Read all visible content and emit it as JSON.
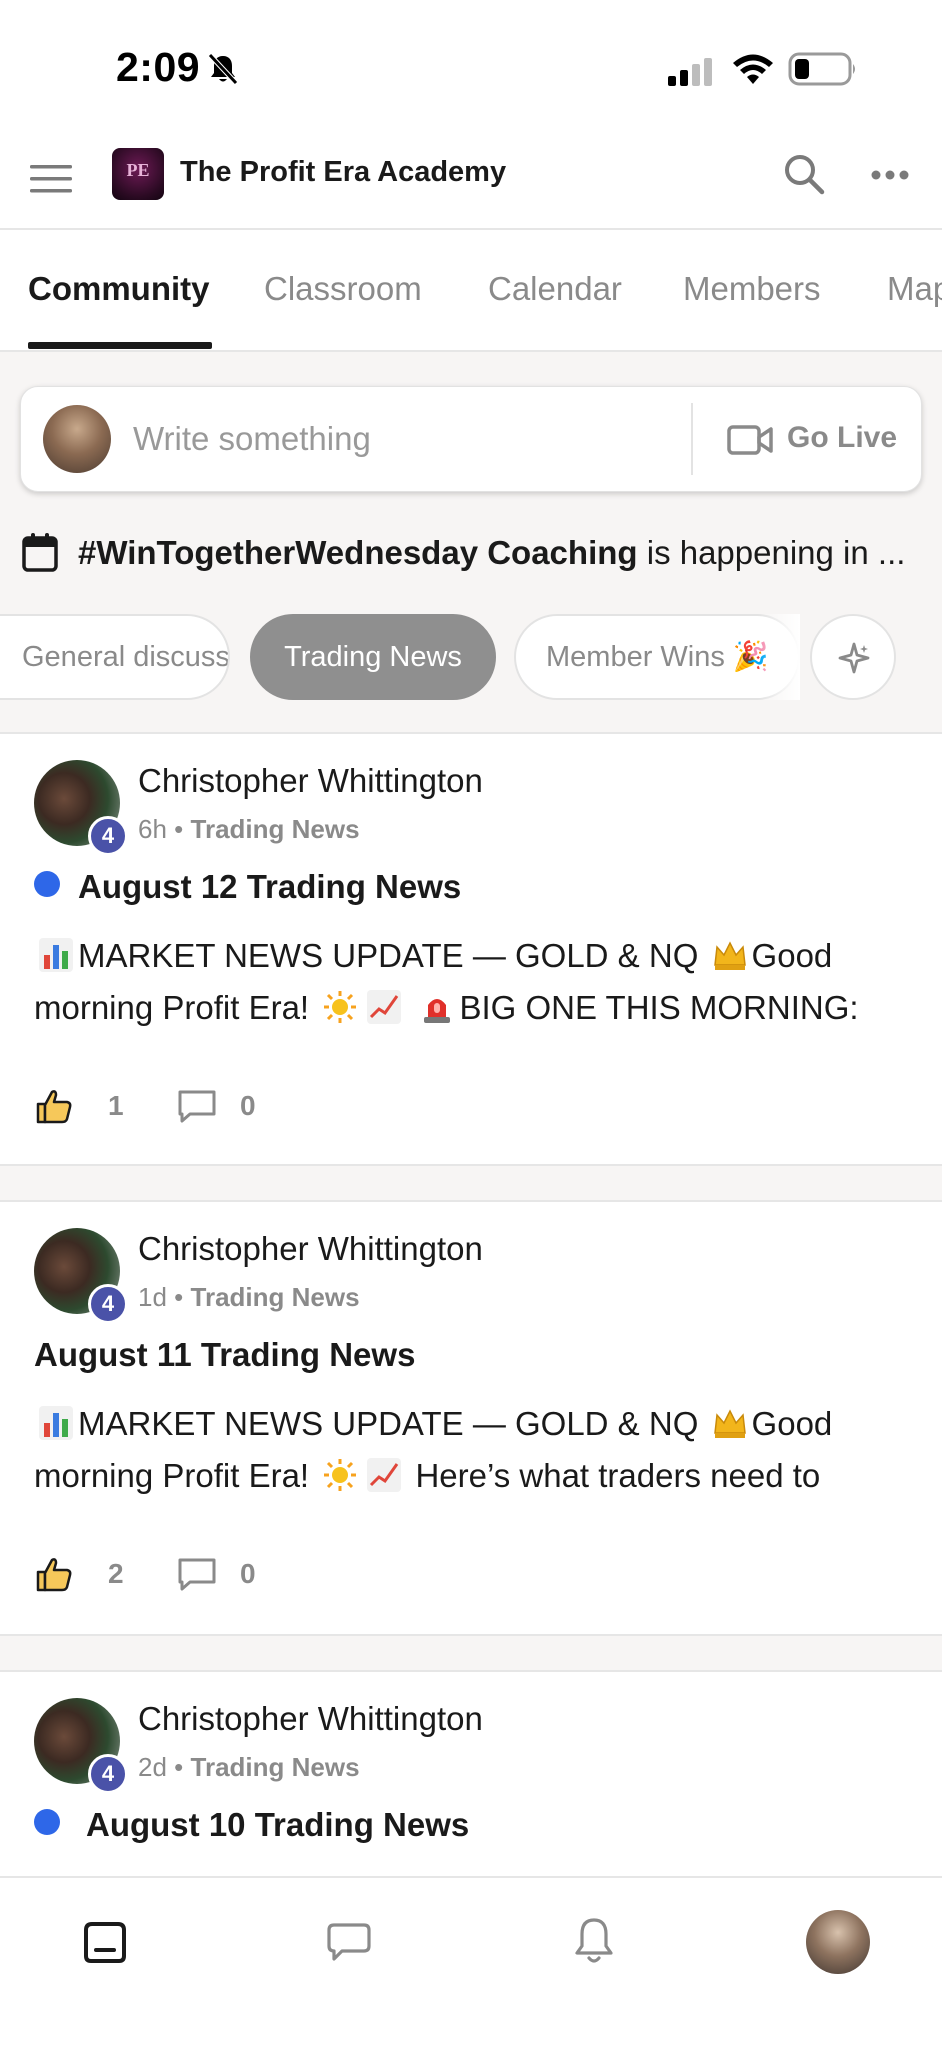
{
  "status_bar": {
    "time": "2:09"
  },
  "header": {
    "app_title": "The Profit Era Academy",
    "logo_text": "PE"
  },
  "tabs": [
    {
      "label": "Community",
      "active": true
    },
    {
      "label": "Classroom",
      "active": false
    },
    {
      "label": "Calendar",
      "active": false
    },
    {
      "label": "Members",
      "active": false
    },
    {
      "label": "Map",
      "active": false
    }
  ],
  "composer": {
    "placeholder": "Write something",
    "go_live_label": "Go Live"
  },
  "event": {
    "title": "#WinTogetherWednesday Coaching",
    "suffix": " is happening in ..."
  },
  "chips": [
    {
      "label": "General discussion",
      "active": false
    },
    {
      "label": "Trading News",
      "active": true
    },
    {
      "label": "Member Wins 🎉",
      "active": false
    }
  ],
  "posts": [
    {
      "author": "Christopher Whittington",
      "level": "4",
      "time": "6h",
      "separator": "•",
      "category": "Trading News",
      "unread": true,
      "title": "August 12 Trading News",
      "body_line1": "MARKET NEWS UPDATE — GOLD & NQ",
      "body_line1_tail": "Good",
      "body_line2_start": "morning Profit Era!",
      "body_line2_end": "BIG ONE THIS MORNING:",
      "likes": "1",
      "comments": "0"
    },
    {
      "author": "Christopher Whittington",
      "level": "4",
      "time": "1d",
      "separator": "•",
      "category": "Trading News",
      "unread": false,
      "title": "August 11 Trading News",
      "body_line1": "MARKET NEWS UPDATE — GOLD & NQ",
      "body_line1_tail": "Good",
      "body_line2_start": "morning Profit Era!",
      "body_line2_end": "Here’s what traders need to",
      "likes": "2",
      "comments": "0"
    },
    {
      "author": "Christopher Whittington",
      "level": "4",
      "time": "2d",
      "separator": "•",
      "category": "Trading News",
      "unread": true,
      "title": "August 10 Trading News"
    }
  ],
  "icons": {
    "menu": "hamburger-icon",
    "search": "search-icon",
    "more": "more-icon",
    "video": "video-camera-icon",
    "calendar": "calendar-icon",
    "sparkle": "sparkle-icon",
    "like": "thumbs-up-icon",
    "comment": "comment-icon",
    "nav_home": "home-icon",
    "nav_chat": "chat-icon",
    "nav_notifications": "bell-icon"
  },
  "colors": {
    "unread_dot": "#2e67e8",
    "level_badge": "#4a52a8",
    "active_chip": "#8f8f8f"
  }
}
